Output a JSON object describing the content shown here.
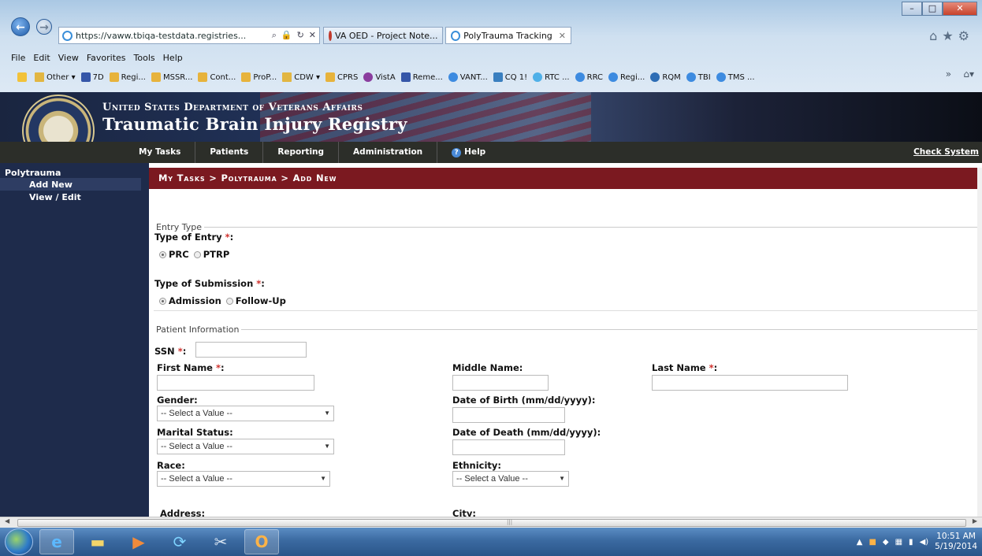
{
  "browser": {
    "address_url": "https://vaww.tbiqa-testdata.registries...",
    "tabs": [
      {
        "label": "VA OED - Project Note..."
      },
      {
        "label": "PolyTrauma Tracking"
      }
    ],
    "menu": [
      "File",
      "Edit",
      "View",
      "Favorites",
      "Tools",
      "Help"
    ],
    "favorites": [
      "Other ▾",
      "7D",
      "Regi...",
      "MSSR...",
      "Cont...",
      "ProP...",
      "CDW ▾",
      "CPRS",
      "VistA",
      "Reme...",
      "VANT...",
      "CQ 1!",
      "RTC ...",
      "RRC",
      "Regi...",
      "RQM",
      "TBI",
      "TMS ..."
    ]
  },
  "banner": {
    "line1": "United States Department of Veterans Affairs",
    "line2": "Traumatic Brain Injury Registry"
  },
  "nav": {
    "items": [
      "My Tasks",
      "Patients",
      "Reporting",
      "Administration"
    ],
    "help": "Help",
    "check_system": "Check System"
  },
  "sidebar": {
    "section": "Polytrauma",
    "items": [
      {
        "label": "Add New",
        "active": true
      },
      {
        "label": "View / Edit",
        "active": false
      }
    ]
  },
  "breadcrumb": "My Tasks > Polytrauma > Add New",
  "entry_type": {
    "legend": "Entry Type",
    "type_of_entry_label": "Type of Entry",
    "entry_options": [
      "PRC",
      "PTRP"
    ],
    "entry_selected": "PRC",
    "submission_label": "Type of Submission",
    "submission_options": [
      "Admission",
      "Follow-Up"
    ],
    "submission_selected": "Admission"
  },
  "patient": {
    "legend": "Patient Information",
    "ssn_label": "SSN",
    "first_name_label": "First Name",
    "middle_name_label": "Middle Name:",
    "last_name_label": "Last Name",
    "gender_label": "Gender:",
    "dob_label": "Date of Birth (mm/dd/yyyy):",
    "marital_label": "Marital Status:",
    "dod_label": "Date of Death (mm/dd/yyyy):",
    "race_label": "Race:",
    "ethnicity_label": "Ethnicity:",
    "address_label": "Address:",
    "city_label": "City:",
    "select_placeholder": "-- Select a Value --",
    "required_mark": "*",
    "colon": ":"
  },
  "taskbar": {
    "time": "10:51 AM",
    "date": "5/19/2014"
  }
}
